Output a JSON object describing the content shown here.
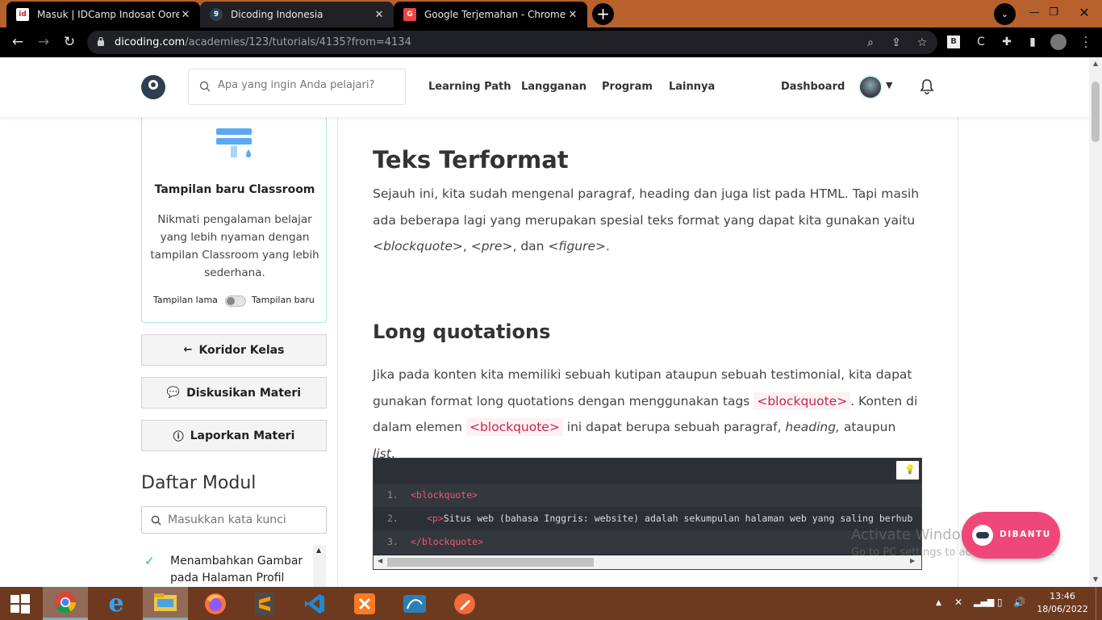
{
  "browser": {
    "tabs": [
      {
        "title": "Masuk | IDCamp Indosat Ooredoo",
        "favicon": "idcamp-icon",
        "active": false
      },
      {
        "title": "Dicoding Indonesia",
        "favicon": "dicoding-icon",
        "active": true
      },
      {
        "title": "Google Terjemahan - Chrome We",
        "favicon": "translate-icon",
        "active": false
      }
    ],
    "url_host": "dicoding.com",
    "url_path": "/academies/123/tutorials/4135?from=4134"
  },
  "header": {
    "search_placeholder": "Apa yang ingin Anda pelajari?",
    "nav": [
      "Learning Path",
      "Langganan",
      "Program",
      "Lainnya"
    ],
    "dashboard": "Dashboard"
  },
  "sidebar": {
    "card_title": "Tampilan baru Classroom",
    "card_desc": "Nikmati pengalaman belajar yang lebih nyaman dengan tampilan Classroom yang lebih sederhana.",
    "toggle_left": "Tampilan lama",
    "toggle_right": "Tampilan baru",
    "buttons": [
      "Koridor Kelas",
      "Diskusikan Materi",
      "Laporkan Materi"
    ],
    "modul_title": "Daftar Modul",
    "modul_search_placeholder": "Masukkan kata kunci",
    "modul_items": [
      "Menambahkan Gambar pada Halaman Profil"
    ]
  },
  "content": {
    "h1": "Teks Terformat",
    "p1": {
      "text": "Sejauh ini, kita sudah mengenal paragraf, heading dan juga list pada HTML. Tapi masih ada beberapa lagi yang merupakan spesial teks format yang dapat kita gunakan yaitu",
      "blockquote": "<blockquote>",
      "pre": "<pre>",
      "and": "dan",
      "figure": "<figure>"
    },
    "h2": "Long quotations",
    "p2": {
      "a": "Jika pada konten kita memiliki sebuah kutipan ataupun sebuah testimonial, kita dapat gunakan format long quotations dengan menggunakan tags",
      "tag1": "<blockquote>",
      "b": ". Konten di dalam elemen",
      "tag2": "<blockquote>",
      "c": "ini dapat berupa sebuah paragraf,",
      "heading": "heading,",
      "d": "ataupun",
      "list": "list",
      "e": "."
    },
    "code": [
      {
        "num": "1.",
        "open": "<blockquote>",
        "text": "",
        "close": ""
      },
      {
        "num": "2.",
        "open": "<p>",
        "text": "Situs web (bahasa Inggris: website) adalah sekumpulan halaman web yang saling berhub",
        "close": ""
      },
      {
        "num": "3.",
        "open": "</blockquote>",
        "text": "",
        "close": ""
      }
    ]
  },
  "overlay": {
    "activate_title": "Activate Windows",
    "activate_sub": "Go to PC settings to activate Windows.",
    "dibantu": "DIBANTU"
  },
  "taskbar": {
    "time": "13:46",
    "date": "18/06/2022"
  },
  "colors": {
    "tabbar": "#b7612c",
    "accent_pink": "#f0477a",
    "code_bg": "#2b2f36",
    "tag_color": "#c7254e"
  }
}
